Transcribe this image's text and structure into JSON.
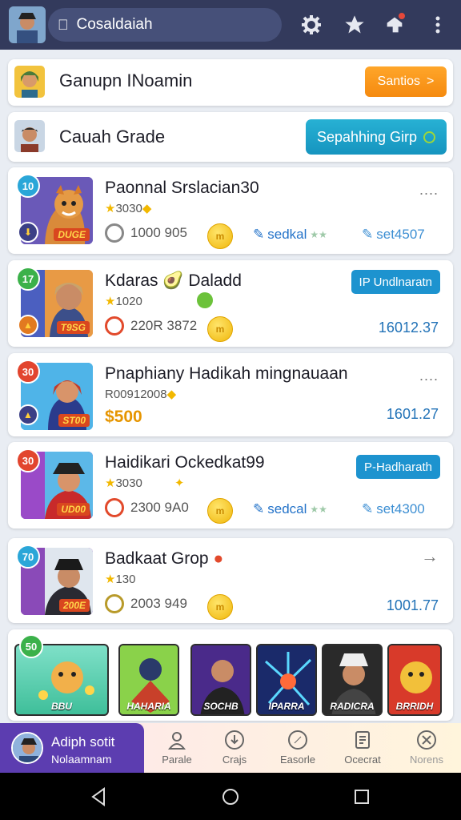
{
  "topbar": {
    "app_name": "Cosaldaiah",
    "icons": [
      "gear-icon",
      "star-icon",
      "notification-icon",
      "more-vertical-icon"
    ]
  },
  "header_card": {
    "title": "Ganupn INoamin",
    "button_label": "Santios",
    "button_arrow": ">"
  },
  "grade_card": {
    "title": "Cauah Grade",
    "button_label": "Sepahhing Girp"
  },
  "games": [
    {
      "rank": "10",
      "title": "Paonnal Srslacian30",
      "sub": "3030",
      "thumb_label": "DUGE",
      "count": "1000 905",
      "coin": "m",
      "tag1": "sedkal",
      "tag2": "set4507",
      "menu": "...."
    },
    {
      "rank": "17",
      "title": "Kdaras 🥑 Daladd",
      "sub": "1020",
      "thumb_label": "T9SG",
      "count": "220R 3872",
      "coin": "m",
      "button": "IP Undlnaratn",
      "value": "16012.37"
    },
    {
      "rank": "30",
      "title": "Pnaphiany Hadikah mingnauaan",
      "sub": "R00912008",
      "thumb_label": "ST00",
      "price": "$500",
      "value": "1601.27",
      "menu": "...."
    },
    {
      "rank": "30",
      "title": "Haidikari Ockedkat99",
      "sub": "3030",
      "thumb_label": "UD00",
      "count": "2300 9A0",
      "coin": "m",
      "button": "P-Hadharath",
      "tag1": "sedcal",
      "tag2": "set4300"
    },
    {
      "rank": "70",
      "title": "Badkaat Grop",
      "sub": "130",
      "thumb_label": "200E",
      "count": "2003 949",
      "coin": "m",
      "value": "1001.77",
      "arrow": "→"
    }
  ],
  "tiles_card": {
    "rank": "50",
    "tiles": [
      {
        "label": "BBU"
      },
      {
        "label": "HAHARIA"
      },
      {
        "label": "SOCHB"
      },
      {
        "label": "IPARRA"
      },
      {
        "label": "RADICRA"
      },
      {
        "label": "BRRIDH"
      }
    ]
  },
  "bottom_nav": {
    "user_name": "Adiph sotit",
    "user_sub": "Nolaamnam",
    "items": [
      {
        "label": "Parale",
        "icon": "person-icon"
      },
      {
        "label": "Crajs",
        "icon": "download-icon"
      },
      {
        "label": "Easorle",
        "icon": "compass-icon"
      },
      {
        "label": "Ocecrat",
        "icon": "document-icon"
      },
      {
        "label": "Norens",
        "icon": "tools-icon"
      }
    ]
  },
  "colors": {
    "topbar": "#333a5c",
    "accent_orange": "#f58a0f",
    "accent_teal": "#1694bf",
    "purple": "#5c3db0"
  }
}
